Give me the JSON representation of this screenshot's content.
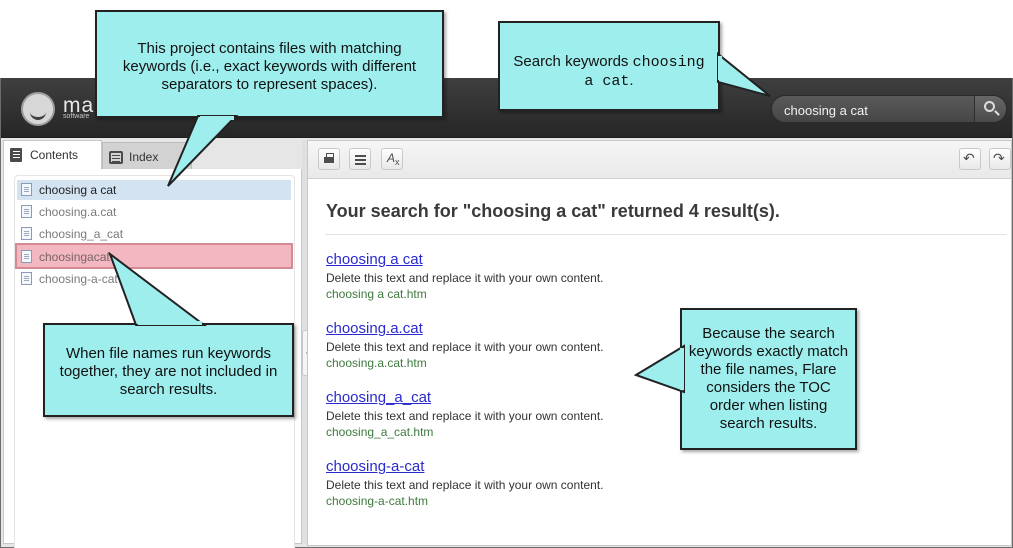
{
  "header": {
    "logo_text": "ma",
    "logo_subtext": "software",
    "search_value": "choosing a cat"
  },
  "tabs": [
    {
      "label": "Contents"
    },
    {
      "label": "Index"
    }
  ],
  "toc": {
    "items": [
      {
        "label": "choosing a cat"
      },
      {
        "label": "choosing.a.cat"
      },
      {
        "label": "choosing_a_cat"
      },
      {
        "label": "choosingacat"
      },
      {
        "label": "choosing-a-cat"
      }
    ]
  },
  "results": {
    "heading": "Your search for \"choosing a cat\" returned 4 result(s).",
    "items": [
      {
        "title": "choosing a cat",
        "description": "Delete this text and replace it with your own content.",
        "file": "choosing a cat.htm"
      },
      {
        "title": "choosing.a.cat",
        "description": "Delete this text and replace it with your own content.",
        "file": "choosing.a.cat.htm"
      },
      {
        "title": "choosing_a_cat",
        "description": "Delete this text and replace it with your own content.",
        "file": "choosing_a_cat.htm"
      },
      {
        "title": "choosing-a-cat",
        "description": "Delete this text and replace it with your own content.",
        "file": "choosing-a-cat.htm"
      }
    ]
  },
  "callouts": {
    "project_matching": "This project contains files with matching keywords (i.e., exact keywords with different separators to represent spaces).",
    "search_keywords_prefix": "Search keywords ",
    "search_keywords_mono": "choosing a cat",
    "search_keywords_suffix": ".",
    "run_together": "When file names run keywords together, they are not included in search results.",
    "toc_order": "Because the search keywords exactly match the file names, Flare considers the TOC order when listing search results."
  },
  "colors": {
    "callout_fill": "#9eeeee",
    "selected_row": "#d3e3f2",
    "excluded_row": "#f2b7c0",
    "link": "#2a2ad0",
    "url": "#3e7a3e"
  }
}
